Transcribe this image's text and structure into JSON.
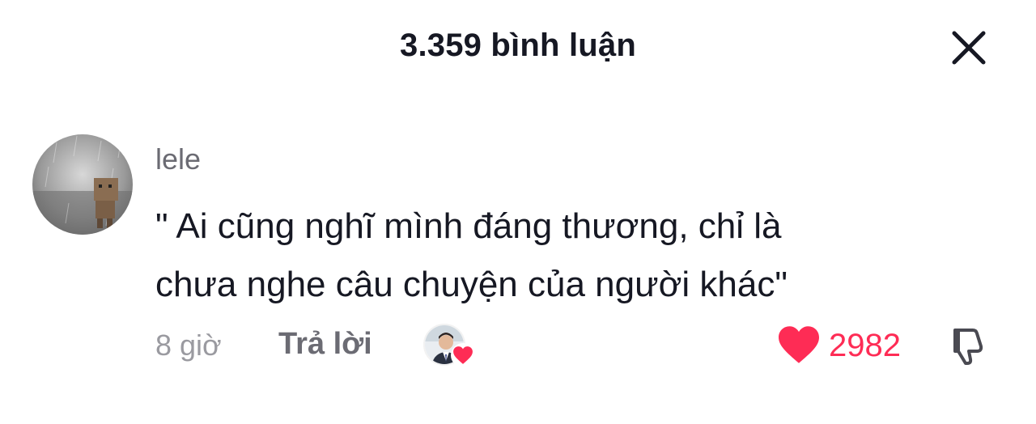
{
  "header": {
    "title": "3.359 bình luận",
    "close_icon": "close-icon"
  },
  "comment": {
    "username": "lele",
    "text": "\" Ai cũng nghĩ mình đáng thương, chỉ là\nchưa nghe câu chuyện của người khác\"",
    "time": "8 giờ",
    "reply_label": "Trả lời",
    "like_count": "2982",
    "creator_liked": true
  },
  "colors": {
    "text_primary": "#161823",
    "text_secondary": "#6b6b73",
    "text_muted": "#9a9aa0",
    "like_red": "#fe2c55"
  }
}
